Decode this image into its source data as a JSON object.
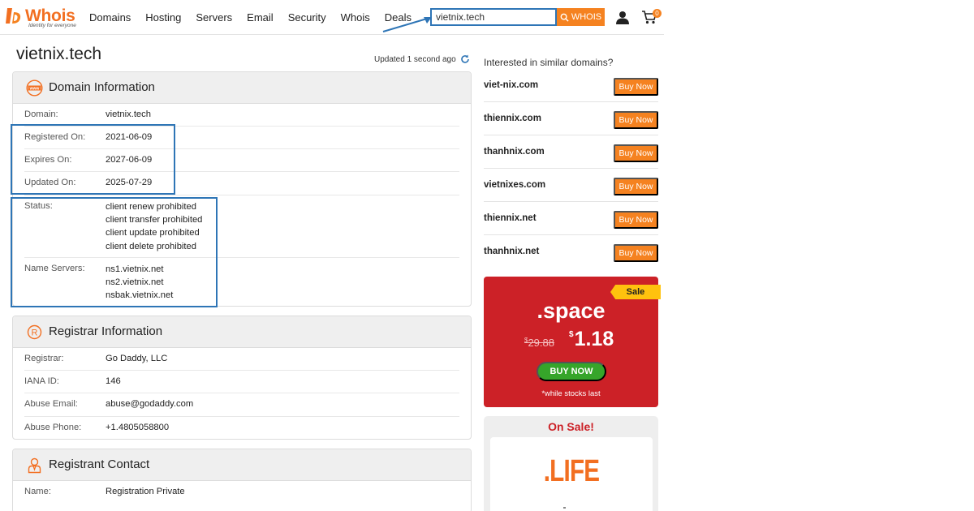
{
  "header": {
    "logo_text": "Whois",
    "logo_tagline": "Identity for everyone",
    "nav": [
      "Domains",
      "Hosting",
      "Servers",
      "Email",
      "Security",
      "Whois",
      "Deals"
    ],
    "search_value": "vietnix.tech",
    "search_button": "WHOIS",
    "cart_count": "0"
  },
  "page": {
    "title": "vietnix.tech",
    "updated": "Updated 1 second ago"
  },
  "domain_info": {
    "title": "Domain Information",
    "rows": [
      {
        "label": "Domain:",
        "value": "vietnix.tech"
      },
      {
        "label": "Registered On:",
        "value": "2021-06-09"
      },
      {
        "label": "Expires On:",
        "value": "2027-06-09"
      },
      {
        "label": "Updated On:",
        "value": "2025-07-29"
      }
    ],
    "status_label": "Status:",
    "status_values": [
      "client renew prohibited",
      "client transfer prohibited",
      "client update prohibited",
      "client delete prohibited"
    ],
    "ns_label": "Name Servers:",
    "ns_values": [
      "ns1.vietnix.net",
      "ns2.vietnix.net",
      "nsbak.vietnix.net"
    ]
  },
  "registrar_info": {
    "title": "Registrar Information",
    "rows": [
      {
        "label": "Registrar:",
        "value": "Go Daddy, LLC"
      },
      {
        "label": "IANA ID:",
        "value": "146"
      },
      {
        "label": "Abuse Email:",
        "value": "abuse@godaddy.com"
      },
      {
        "label": "Abuse Phone:",
        "value": "+1.4805058800"
      }
    ]
  },
  "registrant_contact": {
    "title": "Registrant Contact",
    "rows": [
      {
        "label": "Name:",
        "value": "Registration Private"
      }
    ]
  },
  "similar": {
    "title": "Interested in similar domains?",
    "button_label": "Buy Now",
    "domains": [
      "viet-nix.com",
      "thiennix.com",
      "thanhnix.com",
      "vietnixes.com",
      "thiennix.net",
      "thanhnix.net"
    ]
  },
  "promo": {
    "ribbon": "Sale",
    "tld": ".space",
    "old_currency": "$",
    "old_price": "29.88",
    "new_currency": "$",
    "new_price": "1.18",
    "button": "BUY NOW",
    "note": "*while stocks last"
  },
  "on_sale": {
    "title": "On Sale!",
    "tld": ".LIFE"
  },
  "colors": {
    "brand_orange": "#f58220",
    "promo_red": "#cc2127",
    "highlight_blue": "#2e75b6",
    "cta_green": "#36a52a"
  }
}
